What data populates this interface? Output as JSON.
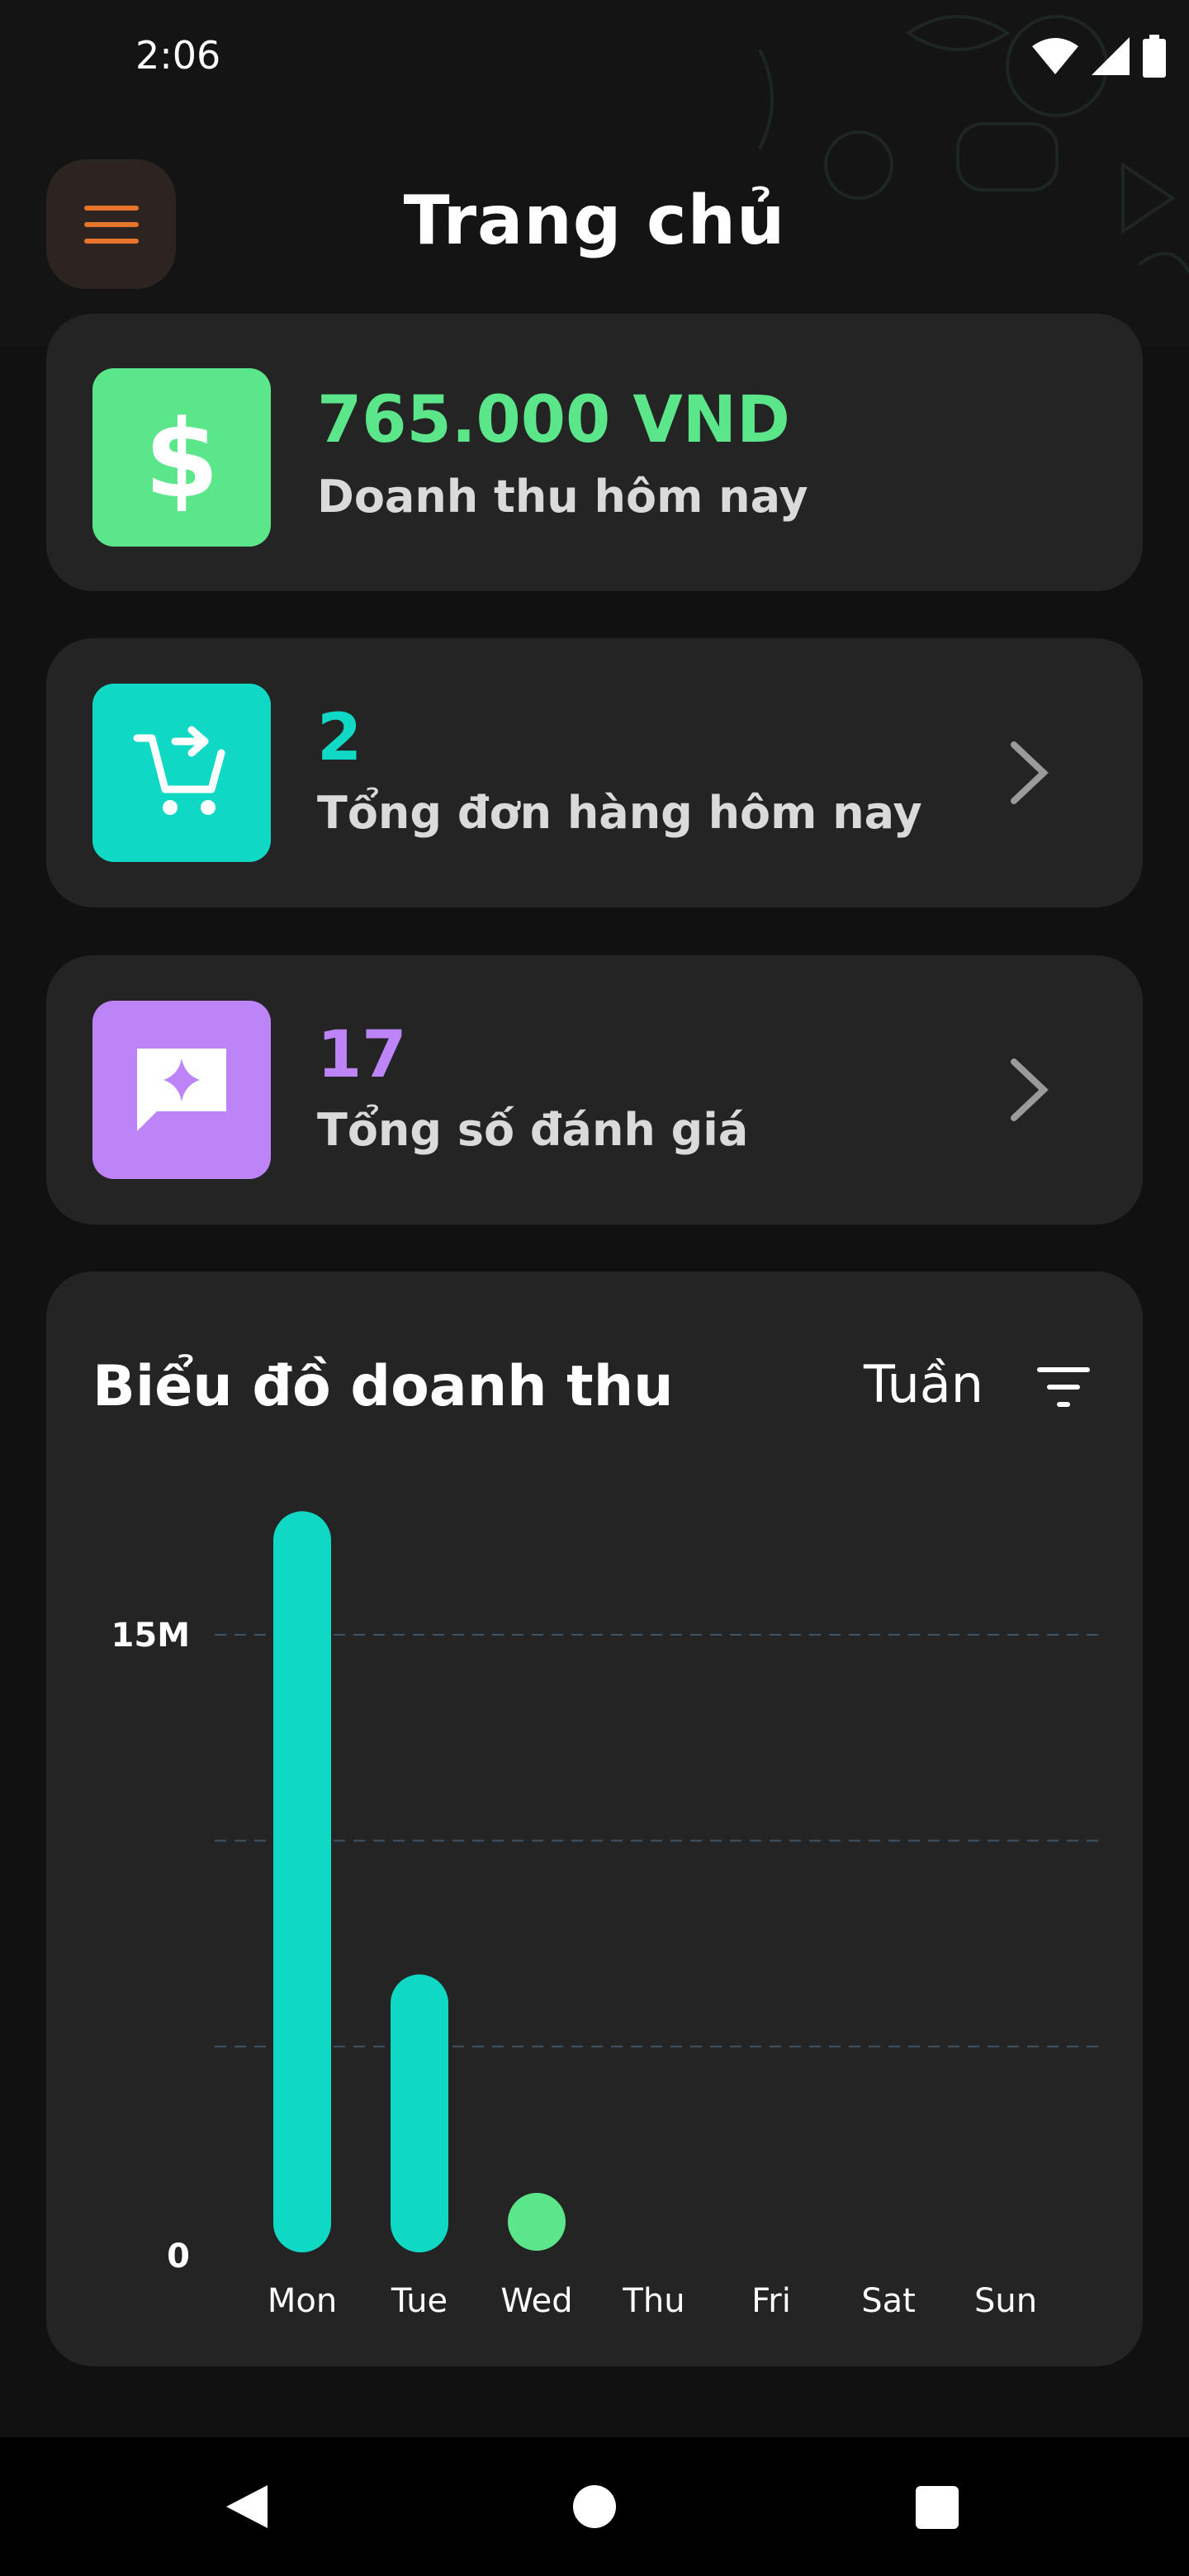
{
  "status": {
    "time": "2:06"
  },
  "header": {
    "title": "Trang chủ"
  },
  "cards": [
    {
      "value": "765.000 VND",
      "label": "Doanh thu hôm nay",
      "color": "#5ce68a",
      "icon": "dollar-icon"
    },
    {
      "value": "2",
      "label": "Tổng đơn hàng hôm nay",
      "color": "#0fd9c4",
      "icon": "cart-icon"
    },
    {
      "value": "17",
      "label": "Tổng số đánh giá",
      "color": "#bd84f7",
      "icon": "review-icon"
    }
  ],
  "chart": {
    "title": "Biểu đồ doanh thu",
    "period": "Tuần"
  },
  "chart_data": {
    "type": "bar",
    "categories": [
      "Mon",
      "Tue",
      "Wed",
      "Thu",
      "Fri",
      "Sat",
      "Sun"
    ],
    "values": [
      18000000,
      6750000,
      765000,
      0,
      0,
      0,
      0
    ],
    "ytick_labels": [
      "0",
      "15M"
    ],
    "ylim": [
      0,
      15000000
    ],
    "grid": true,
    "colors": {
      "bar": "#0fd9c4",
      "highlight": "#5ce68a"
    }
  }
}
